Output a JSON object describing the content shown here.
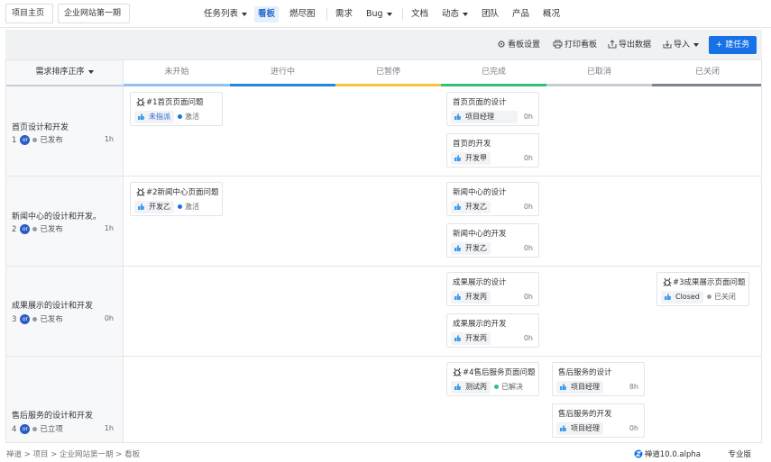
{
  "nav": {
    "project_home": "项目主页",
    "project_name": "企业网站第一期",
    "items": [
      "任务列表",
      "看板",
      "燃尽图",
      "需求",
      "Bug",
      "文档",
      "动态",
      "团队",
      "产品",
      "概况"
    ]
  },
  "toolbar": {
    "board_settings": "看板设置",
    "print_board": "打印看板",
    "export_data": "导出数据",
    "import": "导入",
    "new_task": "+ 建任务"
  },
  "board": {
    "lane_header": "需求排序正序",
    "columns": [
      {
        "label": "未开始",
        "color": "#8fc2f0"
      },
      {
        "label": "进行中",
        "color": "#1e88e5"
      },
      {
        "label": "已暂停",
        "color": "#f5c342"
      },
      {
        "label": "已完成",
        "color": "#2fc27a"
      },
      {
        "label": "已取消",
        "color": "#c9cdd3"
      },
      {
        "label": "已关闭",
        "color": "#7d8490"
      }
    ],
    "lanes": [
      {
        "title": "首页设计和开发",
        "num": "1",
        "avatar": "or",
        "status": "已发布",
        "hours": "1h"
      },
      {
        "title": "新闻中心的设计和开发。",
        "num": "2",
        "avatar": "or",
        "status": "已发布",
        "hours": "1h"
      },
      {
        "title": "成果展示的设计和开发",
        "num": "3",
        "avatar": "or",
        "status": "已发布",
        "hours": "0h"
      },
      {
        "title": "售后服务的设计和开发",
        "num": "4",
        "avatar": "or",
        "status": "已立项",
        "hours": "1h"
      }
    ],
    "cards": {
      "bug1": {
        "title": "#1首页页面问题",
        "assignee": "未指派",
        "status": "激活"
      },
      "t11": {
        "title": "首页页面的设计",
        "assignee": "项目经理",
        "hours": "0h"
      },
      "t12": {
        "title": "首页的开发",
        "assignee": "开发甲",
        "hours": "0h"
      },
      "bug2": {
        "title": "#2新闻中心页面问题",
        "assignee": "开发乙",
        "status": "激活"
      },
      "t21": {
        "title": "新闻中心的设计",
        "assignee": "开发乙",
        "hours": "0h"
      },
      "t22": {
        "title": "新闻中心的开发",
        "assignee": "开发乙",
        "hours": "0h"
      },
      "t31": {
        "title": "成果展示的设计",
        "assignee": "开发丙",
        "hours": "0h"
      },
      "t32": {
        "title": "成果展示的开发",
        "assignee": "开发丙",
        "hours": "0h"
      },
      "bug3": {
        "title": "#3成果展示页面问题",
        "assignee": "Closed",
        "status": "已关闭"
      },
      "bug4": {
        "title": "#4售后服务页面问题",
        "assignee": "测试丙",
        "status": "已解决"
      },
      "t41": {
        "title": "售后服务的设计",
        "assignee": "项目经理",
        "hours": "8h"
      },
      "t42": {
        "title": "售后服务的开发",
        "assignee": "项目经理",
        "hours": "0h"
      }
    }
  },
  "footer": {
    "breadcrumb": "禅道 > 项目 > 企业网站第一期 > 看板",
    "version": "禅道10.0.alpha",
    "edition": "专业版"
  },
  "colors": {
    "accent": "#1672e6",
    "active_status": "#1672e6",
    "resolved": "#2fc27a",
    "closed": "#999999"
  }
}
